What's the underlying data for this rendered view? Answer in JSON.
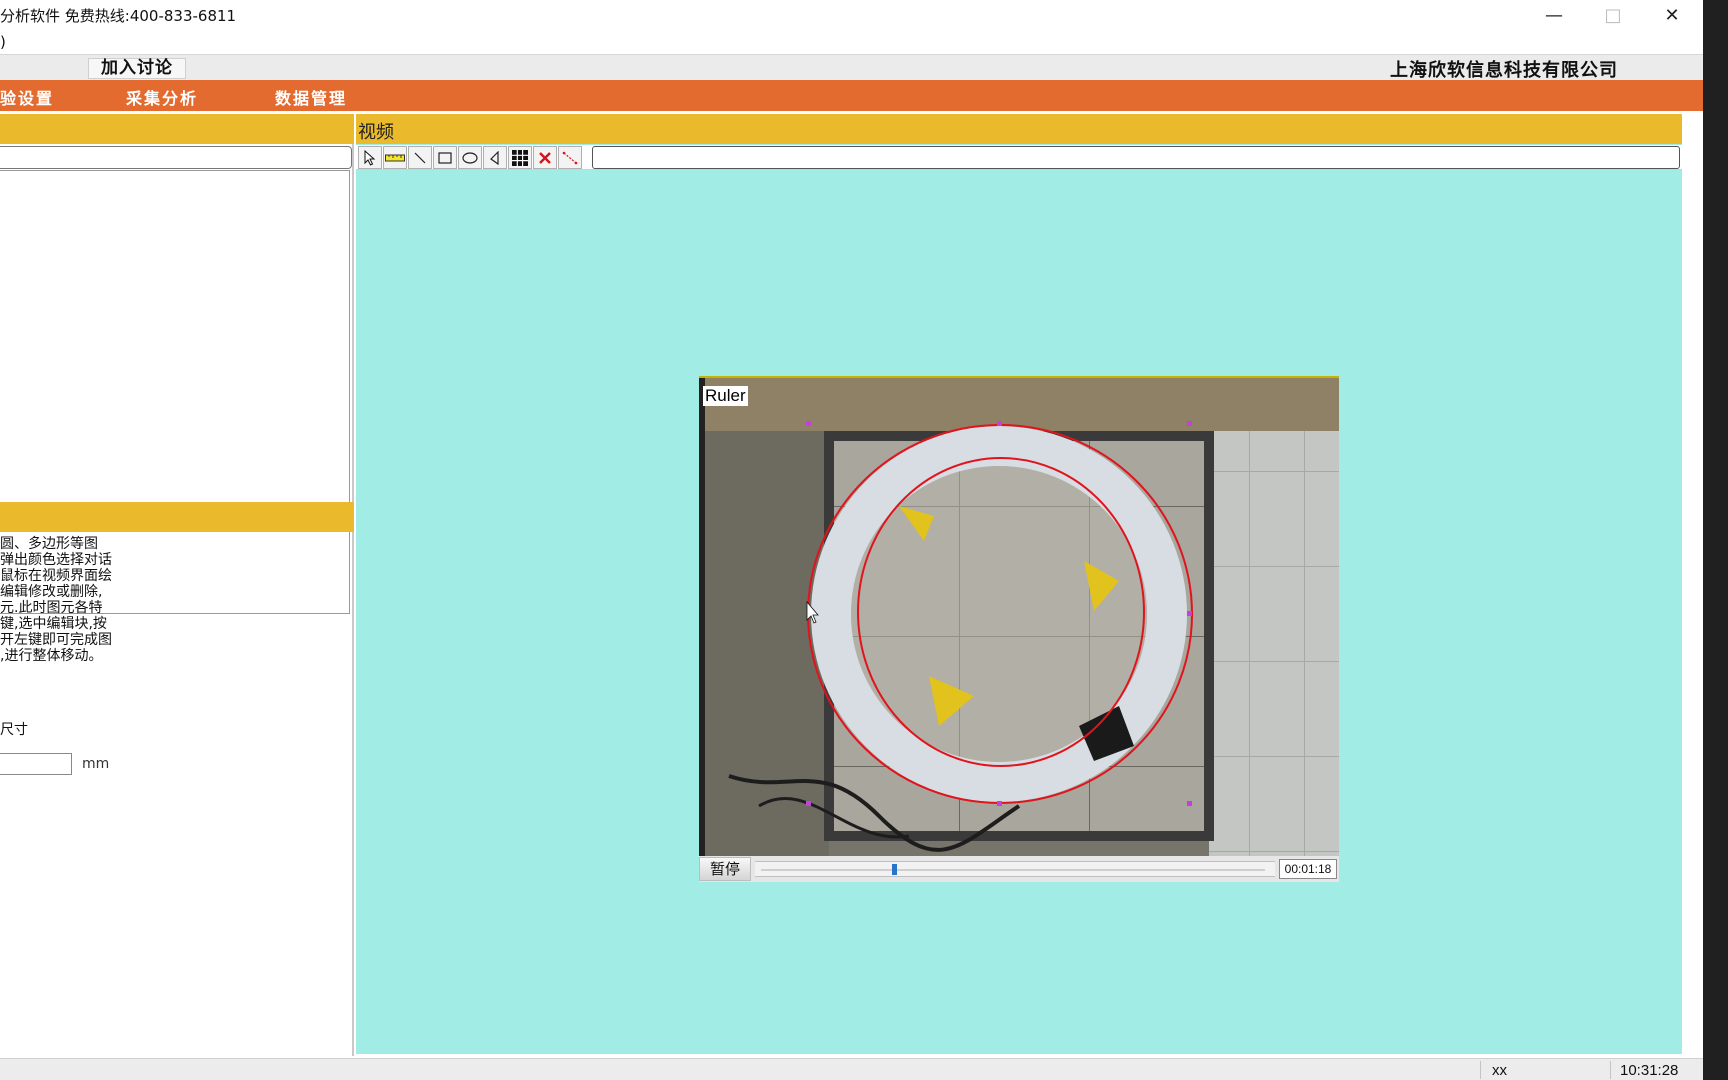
{
  "window": {
    "title": "分析软件   免费热线:400-833-6811",
    "menu_fragment": ")",
    "controls": [
      "minimize-icon",
      "maximize-icon",
      "close-icon"
    ]
  },
  "discussion": {
    "join_label": "加入讨论",
    "company": "上海欣软信息科技有限公司"
  },
  "nav": {
    "items": [
      "验设置",
      "采集分析",
      "数据管理"
    ],
    "color": "#e36b2f"
  },
  "left_panel": {
    "help_lines": [
      "圆、多边形等图",
      "弹出颜色选择对话",
      "鼠标在视频界面绘",
      "编辑修改或删除,",
      "元.此时图元各特",
      "键,选中编辑块,按",
      "开左键即可完成图",
      ",进行整体移动。"
    ],
    "size_label": "尺寸",
    "size_value": "",
    "unit": "mm"
  },
  "video": {
    "title": "视频",
    "tools": [
      "pointer-icon",
      "ruler-icon",
      "line-icon",
      "rectangle-icon",
      "ellipse-icon",
      "polygon-icon",
      "grid-icon",
      "delete-icon",
      "measure-line-icon"
    ],
    "overlay_label": "Ruler",
    "pause_label": "暂停",
    "time": "00:01:18",
    "progress": 0.26
  },
  "status": {
    "user": "xx",
    "clock": "10:31:28"
  },
  "colors": {
    "accent_yellow": "#eab92c",
    "video_bg": "#a2ece6",
    "ruler_red": "#e0141c"
  }
}
